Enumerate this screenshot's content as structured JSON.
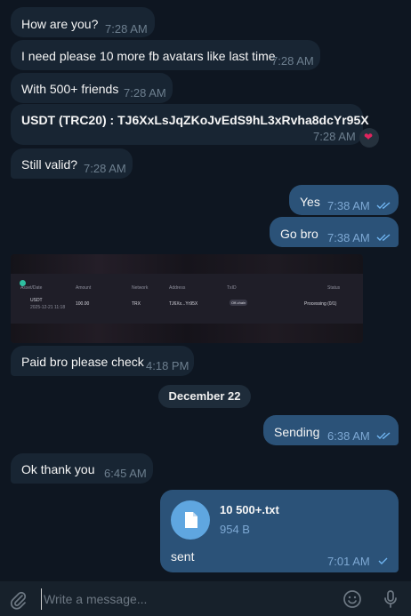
{
  "messages": [
    {
      "text": "How are you?",
      "time": "7:28 AM"
    },
    {
      "text": "I need please 10 more fb avatars like last time",
      "time": "7:28 AM"
    },
    {
      "text": "With 500+ friends",
      "time": "7:28 AM"
    },
    {
      "text": "USDT (TRC20) : TJ6XxLsJqZKoJvEdS9hL3xRvha8dcYr95X",
      "time": "7:28 AM",
      "reaction": "❤"
    },
    {
      "text": "Still valid?",
      "time": "7:28 AM"
    },
    {
      "text": "Yes",
      "time": "7:38 AM"
    },
    {
      "text": "Go bro",
      "time": "7:38 AM"
    },
    {
      "text": "Paid bro please check",
      "time": "4:18 PM"
    },
    {
      "text": "Sending",
      "time": "6:38 AM"
    },
    {
      "text": "Ok thank you",
      "time": "6:45 AM"
    }
  ],
  "image_table": {
    "headers": [
      "Asset/Date",
      "Amount",
      "Network",
      "Address",
      "TxID",
      "Status"
    ],
    "row": {
      "asset": "USDT",
      "date": "2025-12-21 11:18",
      "amount": "100.00",
      "network": "TRX",
      "address": "TJ6Xx...Yr95X",
      "txid": "Off-chain",
      "status": "Processing (0/1)"
    }
  },
  "date_separator": "December 22",
  "file_message": {
    "filename": "10 500+.txt",
    "size": "954 B",
    "caption": "sent",
    "time": "7:01 AM"
  },
  "composer": {
    "placeholder": "Write a message..."
  },
  "colors": {
    "background": "#0e1621",
    "incoming_bubble": "#182533",
    "outgoing_bubble": "#2b5278",
    "accent": "#5fa6e0"
  },
  "icons": [
    "attach-icon",
    "emoji-icon",
    "microphone-icon",
    "double-check-icon",
    "check-icon",
    "file-icon",
    "heart-reaction-icon"
  ]
}
